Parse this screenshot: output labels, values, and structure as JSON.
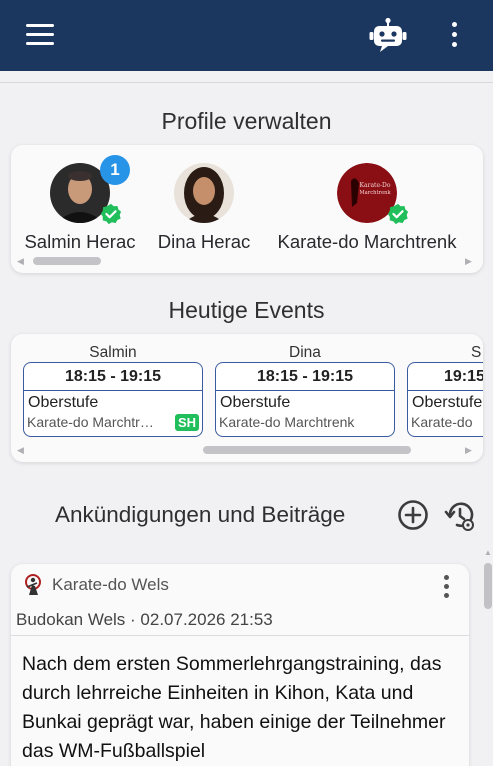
{
  "header": {
    "menu_icon": "hamburger-menu-icon",
    "assistant_icon": "robot-icon",
    "more_icon": "more-vertical-icon",
    "bar_color": "#1b365f"
  },
  "profiles": {
    "title": "Profile verwalten",
    "items": [
      {
        "name": "Salmin Herac",
        "badge_count": "1",
        "verified": true
      },
      {
        "name": "Dina Herac",
        "verified": false
      },
      {
        "name": "Karate-do Marchtrenk",
        "verified": true,
        "logo_text": "Karate-Do Marchtrenk"
      }
    ]
  },
  "events": {
    "title": "Heutige Events",
    "items": [
      {
        "owner": "Salmin",
        "time": "18:15 - 19:15",
        "class": "Oberstufe",
        "club": "Karate-do Marchtr…",
        "tag": "SH"
      },
      {
        "owner": "Dina",
        "time": "18:15 - 19:15",
        "class": "Oberstufe",
        "club": "Karate-do Marchtrenk"
      },
      {
        "owner": "S",
        "time": "19:15",
        "class": "Oberstufe",
        "club": "Karate-do"
      }
    ]
  },
  "announcements": {
    "title": "Ankündigungen und Beiträge",
    "add_icon": "add-circle-icon",
    "history_icon": "history-settings-icon"
  },
  "post": {
    "club": "Karate-do Wels",
    "meta": "Budokan Wels · 02.07.2026 21:53",
    "text": "Nach dem ersten Sommerlehrgangstraining, das durch lehrreiche Einheiten in Kihon, Kata und Bunkai geprägt war, haben einige der Teilnehmer das WM-Fußballspiel",
    "more_icon": "more-vertical-icon"
  },
  "colors": {
    "accent_blue": "#2794e8",
    "verified_green": "#21bf5b",
    "event_border": "#3a5aa0"
  }
}
